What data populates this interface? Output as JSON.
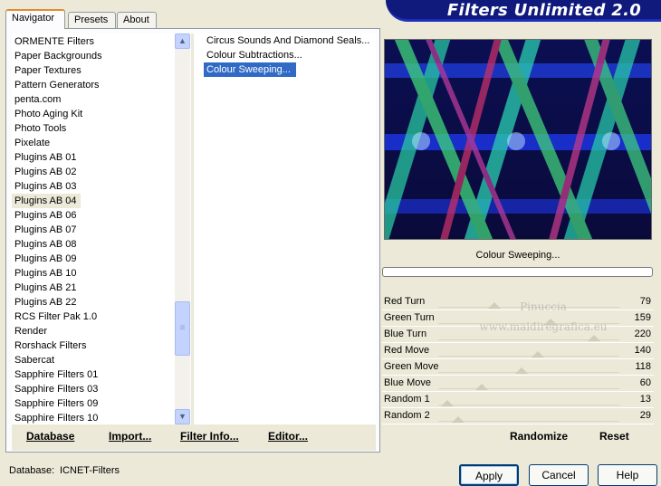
{
  "tabs": [
    "Navigator",
    "Presets",
    "About"
  ],
  "title": "Filters Unlimited 2.0",
  "categories": [
    "ORMENTE Filters",
    "Paper Backgrounds",
    "Paper Textures",
    "Pattern Generators",
    "penta.com",
    "Photo Aging Kit",
    "Photo Tools",
    "Pixelate",
    "Plugins AB 01",
    "Plugins AB 02",
    "Plugins AB 03",
    "Plugins AB 04",
    "Plugins AB 06",
    "Plugins AB 07",
    "Plugins AB 08",
    "Plugins AB 09",
    "Plugins AB 10",
    "Plugins AB 21",
    "Plugins AB 22",
    "RCS Filter Pak 1.0",
    "Render",
    "Rorshack Filters",
    "Sabercat",
    "Sapphire Filters 01",
    "Sapphire Filters 03",
    "Sapphire Filters 09",
    "Sapphire Filters 10"
  ],
  "highlighted_category": "Plugins AB 04",
  "filters": [
    "Circus Sounds And Diamond Seals...",
    "Colour Subtractions...",
    "Colour Sweeping..."
  ],
  "selected_filter": "Colour Sweeping...",
  "bottom_left_buttons": [
    "Database",
    "Import...",
    "Filter Info...",
    "Editor..."
  ],
  "preview_label": "Colour Sweeping...",
  "sliders": [
    {
      "label": "Red Turn",
      "value": "79",
      "level": 0.31
    },
    {
      "label": "Green Turn",
      "value": "159",
      "level": 0.62
    },
    {
      "label": "Blue Turn",
      "value": "220",
      "level": 0.86
    },
    {
      "label": "Red Move",
      "value": "140",
      "level": 0.55
    },
    {
      "label": "Green Move",
      "value": "118",
      "level": 0.46
    },
    {
      "label": "Blue Move",
      "value": "60",
      "level": 0.24
    },
    {
      "label": "Random 1",
      "value": "13",
      "level": 0.05
    },
    {
      "label": "Random 2",
      "value": "29",
      "level": 0.11
    }
  ],
  "watermark": [
    "Pinuccia",
    "www.maidiregrafica.eu"
  ],
  "right_buttons": [
    "Randomize",
    "Reset"
  ],
  "footer": {
    "database_label": "Database:",
    "database_value": "ICNET-Filters"
  },
  "dialog_buttons": [
    "Apply",
    "Cancel",
    "Help"
  ],
  "colors": {
    "selection": "#316ac5",
    "banner": "#0f1a7c",
    "dialog_bg": "#ece9d8"
  }
}
